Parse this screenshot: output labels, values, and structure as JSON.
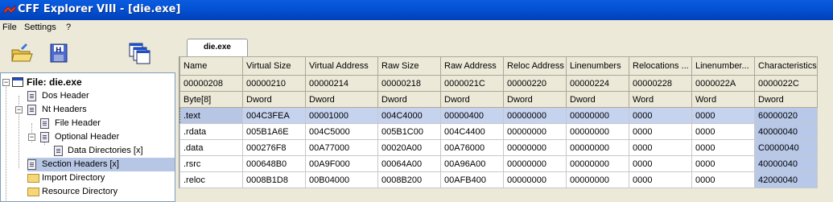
{
  "window": {
    "title": "CFF Explorer VIII - [die.exe]"
  },
  "menu": [
    "File",
    "Settings",
    "?"
  ],
  "toolbar": {
    "buttons": [
      "open-folder-icon",
      "save-disk-icon",
      "windows-icon"
    ]
  },
  "tree": {
    "root": "File: die.exe",
    "nodes": {
      "dos": "Dos Header",
      "nt": "Nt Headers",
      "file": "File Header",
      "optional": "Optional Header",
      "datadir": "Data Directories [x]",
      "section": "Section Headers [x]",
      "import": "Import Directory",
      "resource": "Resource Directory"
    }
  },
  "tab": {
    "label": "die.exe"
  },
  "table": {
    "headers": [
      "Name",
      "Virtual Size",
      "Virtual Address",
      "Raw Size",
      "Raw Address",
      "Reloc Address",
      "Linenumbers",
      "Relocations ...",
      "Linenumber...",
      "Characteristics"
    ],
    "offsets": [
      "00000208",
      "00000210",
      "00000214",
      "00000218",
      "0000021C",
      "00000220",
      "00000224",
      "00000228",
      "0000022A",
      "0000022C"
    ],
    "types": [
      "Byte[8]",
      "Dword",
      "Dword",
      "Dword",
      "Dword",
      "Dword",
      "Dword",
      "Word",
      "Word",
      "Dword"
    ],
    "rows": [
      [
        ".text",
        "004C3FEA",
        "00001000",
        "004C4000",
        "00000400",
        "00000000",
        "00000000",
        "0000",
        "0000",
        "60000020"
      ],
      [
        ".rdata",
        "005B1A6E",
        "004C5000",
        "005B1C00",
        "004C4400",
        "00000000",
        "00000000",
        "0000",
        "0000",
        "40000040"
      ],
      [
        ".data",
        "000276F8",
        "00A77000",
        "00020A00",
        "00A76000",
        "00000000",
        "00000000",
        "0000",
        "0000",
        "C0000040"
      ],
      [
        ".rsrc",
        "000648B0",
        "00A9F000",
        "00064A00",
        "00A96A00",
        "00000000",
        "00000000",
        "0000",
        "0000",
        "40000040"
      ],
      [
        ".reloc",
        "0008B1D8",
        "00B04000",
        "0008B200",
        "00AFB400",
        "00000000",
        "00000000",
        "0000",
        "0000",
        "42000040"
      ]
    ]
  }
}
